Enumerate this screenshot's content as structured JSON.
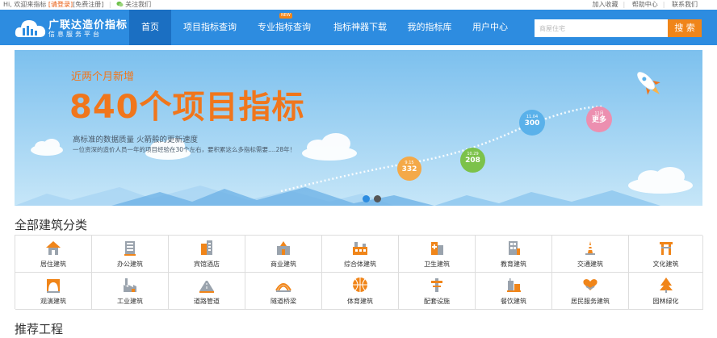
{
  "topbar": {
    "greeting": "Hi, 欢迎来指标",
    "login": "[请登录]",
    "register": "[免费注册]",
    "follow": "关注我们",
    "links": [
      "加入收藏",
      "帮助中心",
      "联系我们"
    ]
  },
  "header": {
    "logo_title": "广联达造价指标",
    "logo_sub": "信息服务平台",
    "nav": [
      {
        "label": "首页",
        "active": true
      },
      {
        "label": "项目指标查询"
      },
      {
        "label": "专业指标查询",
        "badge": "NEW"
      },
      {
        "label": "指标神器下载"
      },
      {
        "label": "我的指标库"
      },
      {
        "label": "用户中心"
      }
    ],
    "search_placeholder": "商屋住宅",
    "search_button": "搜 索"
  },
  "banner": {
    "subtitle": "近两个月新增",
    "headline": "840个项目指标",
    "line1": "高标准的数据质量    火箭般的更新速度",
    "line2": "一位资深的造价人员一年的项目经验在30个左右，要积累这么多指标需要....28年！",
    "milestones": [
      {
        "date": "9.15",
        "value": "332",
        "color": "#f4a948"
      },
      {
        "date": "10.29",
        "value": "208",
        "color": "#7cc24a"
      },
      {
        "date": "11.04",
        "value": "300",
        "color": "#5ab1ea"
      },
      {
        "date": "11月",
        "value": "更多",
        "color": "#ec8fb0"
      }
    ],
    "carousel_active": 0
  },
  "categories": {
    "title": "全部建筑分类",
    "items": [
      {
        "label": "居住建筑",
        "icon": "house-icon"
      },
      {
        "label": "办公建筑",
        "icon": "office-building-icon"
      },
      {
        "label": "宾馆酒店",
        "icon": "hotel-icon"
      },
      {
        "label": "商业建筑",
        "icon": "commercial-building-icon"
      },
      {
        "label": "综合体建筑",
        "icon": "complex-building-icon"
      },
      {
        "label": "卫生建筑",
        "icon": "hospital-icon"
      },
      {
        "label": "教育建筑",
        "icon": "school-icon"
      },
      {
        "label": "交通建筑",
        "icon": "traffic-cone-icon"
      },
      {
        "label": "文化建筑",
        "icon": "gate-icon"
      },
      {
        "label": "观演建筑",
        "icon": "theater-icon"
      },
      {
        "label": "工业建筑",
        "icon": "factory-icon"
      },
      {
        "label": "道路管道",
        "icon": "road-icon"
      },
      {
        "label": "隧道桥梁",
        "icon": "bridge-arch-icon"
      },
      {
        "label": "体育建筑",
        "icon": "basketball-icon"
      },
      {
        "label": "配套设施",
        "icon": "facility-icon"
      },
      {
        "label": "餐饮建筑",
        "icon": "restaurant-icon"
      },
      {
        "label": "居民服务建筑",
        "icon": "heart-hands-icon"
      },
      {
        "label": "园林绿化",
        "icon": "tree-icon"
      }
    ]
  },
  "recommend": {
    "title": "推荐工程"
  }
}
